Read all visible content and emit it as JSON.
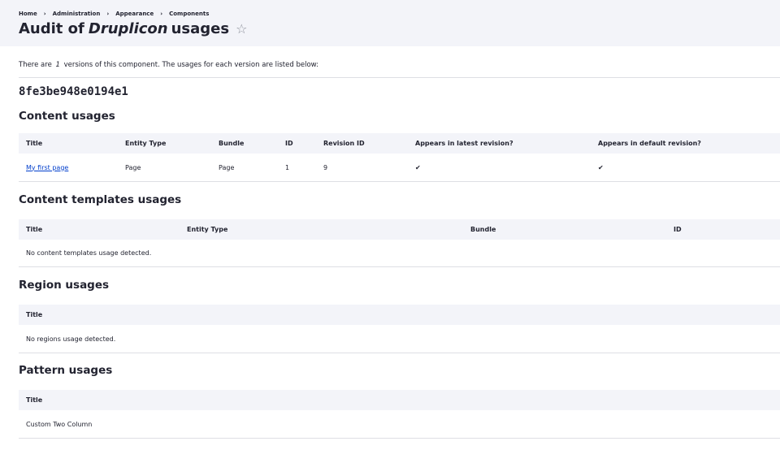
{
  "breadcrumb": [
    "Home",
    "Administration",
    "Appearance",
    "Components"
  ],
  "breadcrumb_separator": "›",
  "title": {
    "prefix": "Audit of",
    "component": "Druplicon",
    "suffix": "usages"
  },
  "intro": {
    "before": "There are",
    "count": "1",
    "after": "versions of this component. The usages for each version are listed below:"
  },
  "version_id": "8fe3be948e0194e1",
  "content_usages": {
    "heading": "Content usages",
    "columns": [
      "Title",
      "Entity Type",
      "Bundle",
      "ID",
      "Revision ID",
      "Appears in latest revision?",
      "Appears in default revision?"
    ],
    "rows": [
      {
        "title": "My first page",
        "entity_type": "Page",
        "bundle": "Page",
        "id": "1",
        "revision_id": "9",
        "latest": "✔",
        "default": "✔"
      }
    ]
  },
  "content_templates_usages": {
    "heading": "Content templates usages",
    "columns": [
      "Title",
      "Entity Type",
      "Bundle",
      "ID"
    ],
    "empty_message": "No content templates usage detected."
  },
  "region_usages": {
    "heading": "Region usages",
    "columns": [
      "Title"
    ],
    "empty_message": "No regions usage detected."
  },
  "pattern_usages": {
    "heading": "Pattern usages",
    "columns": [
      "Title"
    ],
    "rows": [
      {
        "title": "Custom Two Column"
      }
    ]
  },
  "colors": {
    "accent_link": "#003ecc",
    "header_bg": "#f3f4f9",
    "text": "#222330",
    "border": "#dedfe4"
  }
}
